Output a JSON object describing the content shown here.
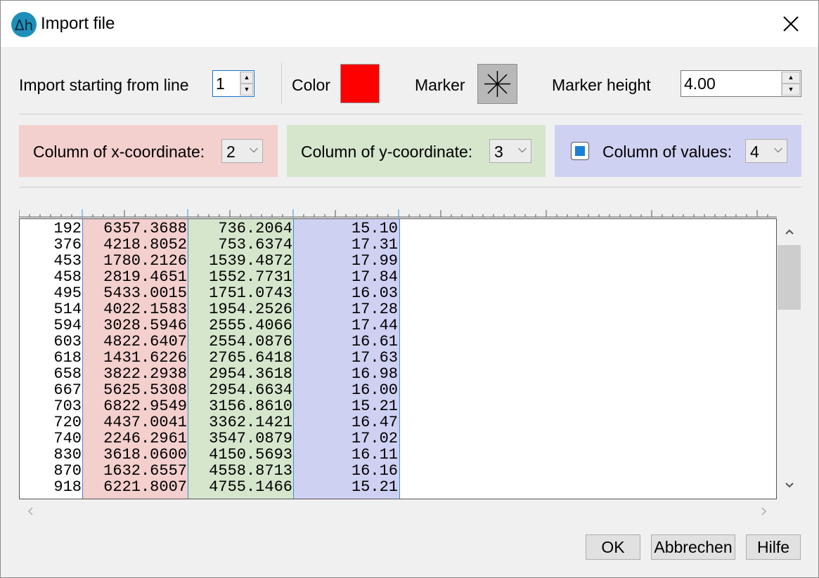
{
  "window": {
    "title": "Import file",
    "icon_text": "Δh"
  },
  "import": {
    "starting_line_label": "Import starting from line",
    "starting_line_value": "1",
    "color_label": "Color",
    "color_value": "#ff0000",
    "marker_label": "Marker",
    "marker_icon": "asterisk-marker-icon",
    "marker_height_label": "Marker height",
    "marker_height_value": "4.00"
  },
  "columns": {
    "x": {
      "label": "Column of x-coordinate:",
      "value": "2",
      "bg": "#f3cfcd"
    },
    "y": {
      "label": "Column of y-coordinate:",
      "value": "3",
      "bg": "#d5e6cd"
    },
    "values": {
      "label": "Column of values:",
      "value": "4",
      "bg": "#cfd1f3",
      "checked": true
    }
  },
  "table": {
    "rows": [
      [
        "192",
        "6357.3688",
        "736.2064",
        "15.10"
      ],
      [
        "376",
        "4218.8052",
        "753.6374",
        "17.31"
      ],
      [
        "453",
        "1780.2126",
        "1539.4872",
        "17.99"
      ],
      [
        "458",
        "2819.4651",
        "1552.7731",
        "17.84"
      ],
      [
        "495",
        "5433.0015",
        "1751.0743",
        "16.03"
      ],
      [
        "514",
        "4022.1583",
        "1954.2526",
        "17.28"
      ],
      [
        "594",
        "3028.5946",
        "2555.4066",
        "17.44"
      ],
      [
        "603",
        "4822.6407",
        "2554.0876",
        "16.61"
      ],
      [
        "618",
        "1431.6226",
        "2765.6418",
        "17.63"
      ],
      [
        "658",
        "3822.2938",
        "2954.3618",
        "16.98"
      ],
      [
        "667",
        "5625.5308",
        "2954.6634",
        "16.00"
      ],
      [
        "703",
        "6822.9549",
        "3156.8610",
        "15.21"
      ],
      [
        "720",
        "4437.0041",
        "3362.1421",
        "16.47"
      ],
      [
        "740",
        "2246.2961",
        "3547.0879",
        "17.02"
      ],
      [
        "830",
        "3618.0600",
        "4150.5693",
        "16.11"
      ],
      [
        "870",
        "1632.6557",
        "4558.8713",
        "16.16"
      ],
      [
        "918",
        "6221.8007",
        "4755.1466",
        "15.21"
      ]
    ]
  },
  "buttons": {
    "ok": "OK",
    "cancel": "Abbrechen",
    "help": "Hilfe"
  }
}
